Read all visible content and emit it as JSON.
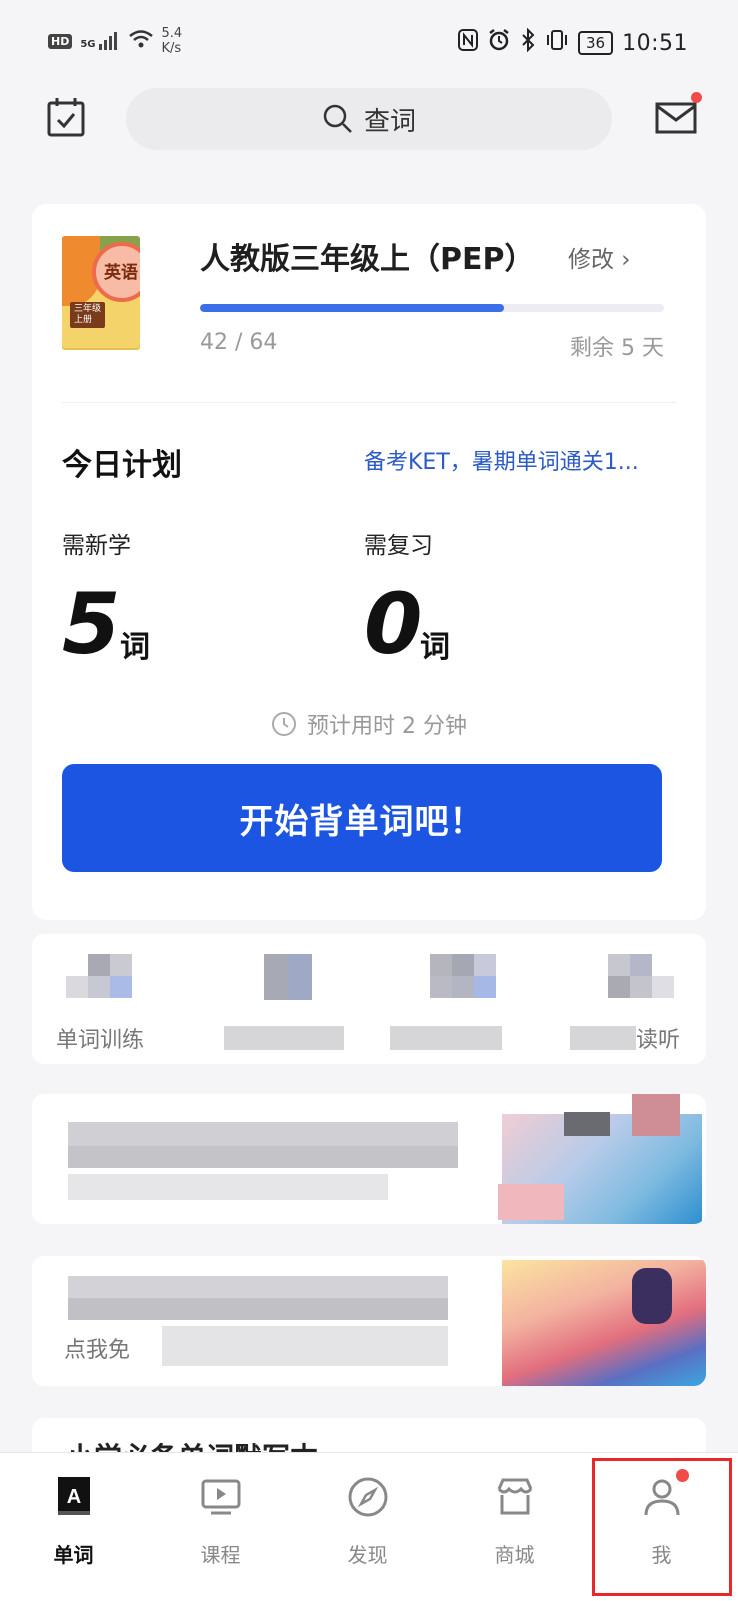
{
  "status_bar": {
    "hd": "HD",
    "signal": "5G",
    "net_speed_value": "5.4",
    "net_speed_unit": "K/s",
    "battery": "36",
    "time": "10:51"
  },
  "header": {
    "search_placeholder": "查词",
    "mail_has_unread": true
  },
  "book": {
    "cover_title": "英语",
    "cover_grade": "三年级",
    "cover_volume": "上册",
    "title": "人教版三年级上（PEP）",
    "edit_label": "修改 ›",
    "progress_text": "42 / 64",
    "progress_fraction": 0.656,
    "remaining": "剩余 5 天"
  },
  "plan": {
    "title": "今日计划",
    "link": "备考KET，暑期单词通关1...",
    "new_label": "需新学",
    "new_count": "5",
    "review_label": "需复习",
    "review_count": "0",
    "unit": "词",
    "estimate": "预计用时 2 分钟",
    "start_label": "开始背单词吧！"
  },
  "tiles": {
    "first_label": "单词训练",
    "last_label_suffix": "读听"
  },
  "banners": {
    "second_label": "点我免"
  },
  "partial_card": {
    "title": "小学必备单词默写本"
  },
  "tab_bar": {
    "items": [
      {
        "label": "单词",
        "icon": "word-book-icon",
        "active": true
      },
      {
        "label": "课程",
        "icon": "video-course-icon",
        "active": false
      },
      {
        "label": "发现",
        "icon": "compass-icon",
        "active": false
      },
      {
        "label": "商城",
        "icon": "store-icon",
        "active": false
      },
      {
        "label": "我",
        "icon": "person-icon",
        "active": false,
        "badge": true
      }
    ]
  },
  "colors": {
    "accent": "#1b55e2",
    "progress": "#3b6ee8",
    "badge": "#f04a4a",
    "highlight": "#e8272a",
    "link": "#2c5bc4"
  }
}
